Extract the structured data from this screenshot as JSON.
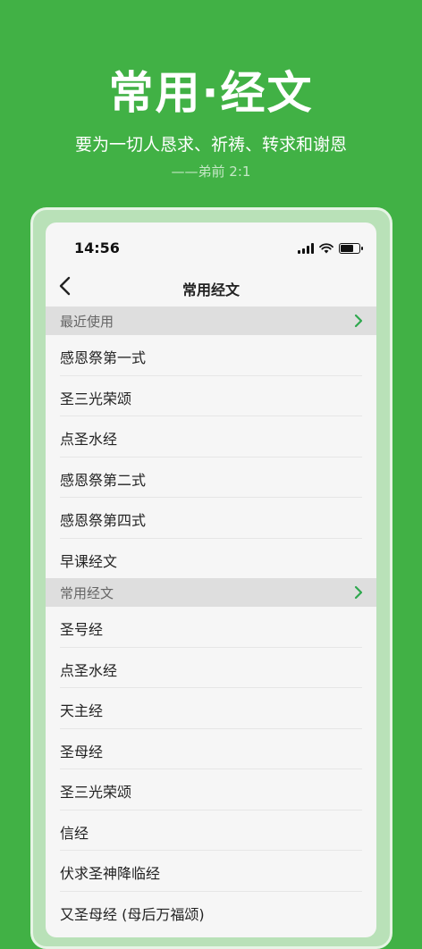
{
  "hero": {
    "title": "常用·经文",
    "subtitle": "要为一切人恳求、祈祷、转求和谢恩",
    "reference": "——弟前 2:1"
  },
  "status_bar": {
    "time": "14:56"
  },
  "nav": {
    "title": "常用经文"
  },
  "sections": [
    {
      "label": "最近使用",
      "items": [
        "感恩祭第一式",
        "圣三光荣颂",
        "点圣水经",
        "感恩祭第二式",
        "感恩祭第四式",
        "早课经文"
      ]
    },
    {
      "label": "常用经文",
      "items": [
        "圣号经",
        "点圣水经",
        "天主经",
        "圣母经",
        "圣三光荣颂",
        "信经",
        "伏求圣神降临经",
        "又圣母经 (母后万福颂)"
      ]
    }
  ],
  "colors": {
    "brand_green": "#41b145",
    "chevron_green": "#2fa84f"
  },
  "icons": [
    "back-icon",
    "chevron-right-icon",
    "signal-icon",
    "wifi-icon",
    "battery-icon"
  ]
}
